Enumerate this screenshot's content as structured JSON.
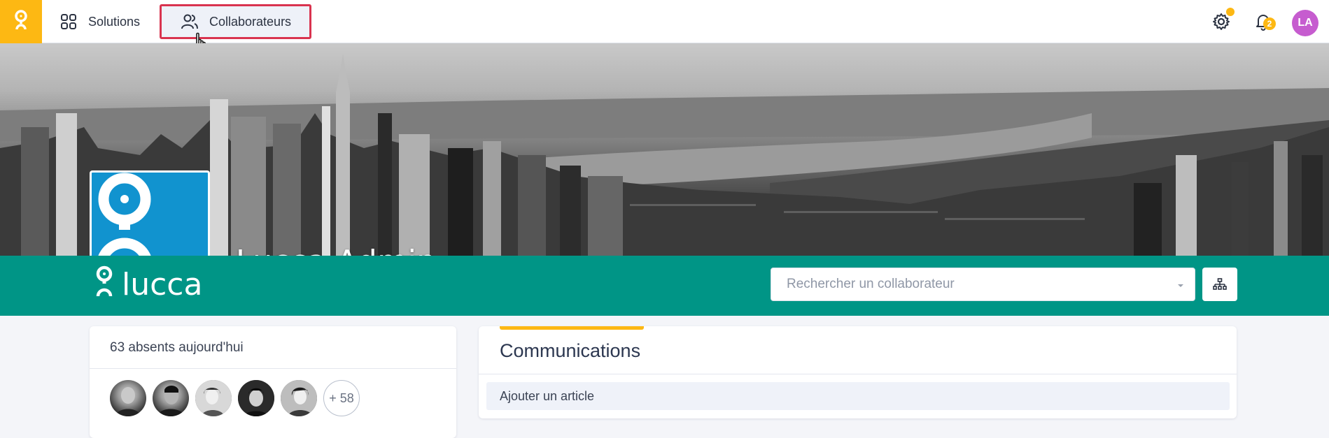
{
  "nav": {
    "solutions_label": "Solutions",
    "collaborators_label": "Collaborateurs",
    "notification_count": "2",
    "user_initials": "LA"
  },
  "company": {
    "name": "Lucca Admin",
    "brand_word": "lucca"
  },
  "search": {
    "placeholder": "Rechercher un collaborateur"
  },
  "absences": {
    "title": "63 absents aujourd'hui",
    "more_label": "+ 58"
  },
  "communications": {
    "title": "Communications",
    "add_article_label": "Ajouter un article"
  },
  "colors": {
    "brand_yellow": "#fdb813",
    "teal": "#009586",
    "logo_blue": "#1193cf",
    "highlight_red": "#d9334f",
    "avatar_purple": "#c65ccf"
  }
}
